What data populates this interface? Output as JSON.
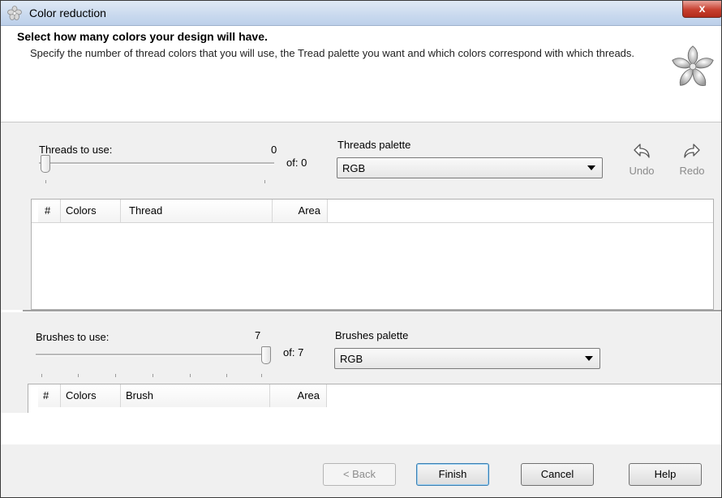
{
  "window": {
    "title": "Color reduction",
    "close_label": "x"
  },
  "header": {
    "title": "Select how many colors your design will have.",
    "description": "Specify the number of thread colors that you will use, the Tread palette you want and which colors correspond with which threads."
  },
  "threads": {
    "label": "Threads to use:",
    "value": "0",
    "of_label": "of: 0",
    "slider_fraction": 0,
    "palette_label": "Threads palette",
    "palette_value": "RGB",
    "columns": [
      "#",
      "Colors",
      "Thread",
      "Area"
    ]
  },
  "toolbar": {
    "undo_label": "Undo",
    "redo_label": "Redo"
  },
  "brushes": {
    "label": "Brushes to use:",
    "value": "7",
    "of_label": "of: 7",
    "slider_fraction": 1,
    "palette_label": "Brushes palette",
    "palette_value": "RGB",
    "columns": [
      "#",
      "Colors",
      "Brush",
      "Area"
    ]
  },
  "footer": {
    "back_label": "< Back",
    "finish_label": "Finish",
    "cancel_label": "Cancel",
    "help_label": "Help"
  }
}
